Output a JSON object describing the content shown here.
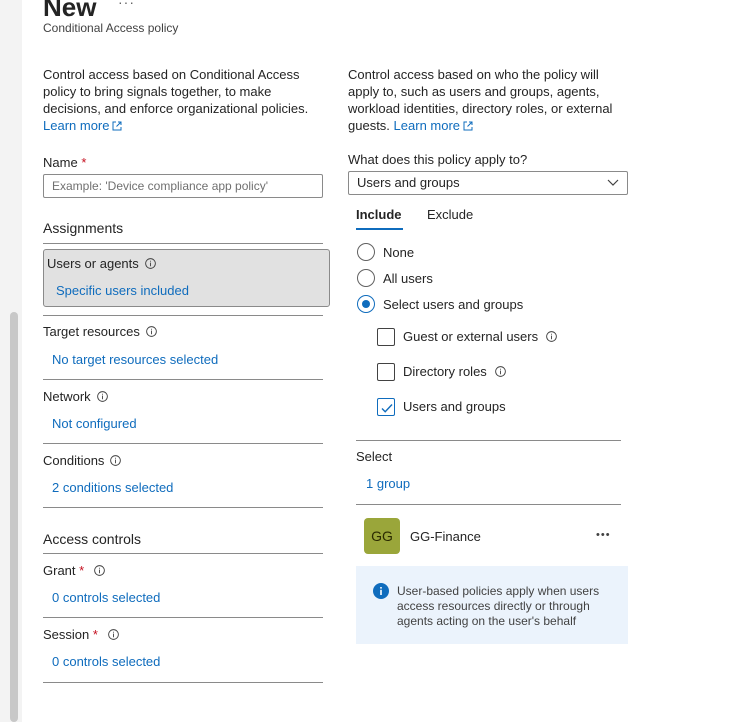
{
  "header": {
    "title": "New",
    "more": "···",
    "subtitle": "Conditional Access policy"
  },
  "left": {
    "description": "Control access based on Conditional Access policy to bring signals together, to make decisions, and enforce organizational policies.",
    "learn_more": "Learn more",
    "name_label": "Name",
    "required_mark": "*",
    "name_placeholder": "Example: 'Device compliance app policy'",
    "assignments_heading": "Assignments",
    "assignments": [
      {
        "label": "Users or agents",
        "value": "Specific users included"
      },
      {
        "label": "Target resources",
        "value": "No target resources selected"
      },
      {
        "label": "Network",
        "value": "Not configured"
      },
      {
        "label": "Conditions",
        "value": "2 conditions selected"
      }
    ],
    "access_heading": "Access controls",
    "access": [
      {
        "label": "Grant",
        "value": "0 controls selected"
      },
      {
        "label": "Session",
        "value": "0 controls selected"
      }
    ]
  },
  "right": {
    "description": "Control access based on who the policy will apply to, such as users and groups, agents, workload identities, directory roles, or external guests.",
    "learn_more": "Learn more",
    "apply_label": "What does this policy apply to?",
    "apply_value": "Users and groups",
    "tabs": [
      "Include",
      "Exclude"
    ],
    "radios": [
      {
        "label": "None",
        "checked": false
      },
      {
        "label": "All users",
        "checked": false
      },
      {
        "label": "Select users and groups",
        "checked": true
      }
    ],
    "checkboxes": [
      {
        "label": "Guest or external users",
        "checked": false
      },
      {
        "label": "Directory roles",
        "checked": false
      },
      {
        "label": "Users and groups",
        "checked": true
      }
    ],
    "select_label": "Select",
    "select_value": "1 group",
    "member": {
      "initials": "GG",
      "name": "GG-Finance",
      "more": "•••"
    },
    "info_text": "User-based policies apply when users access resources directly or through agents acting on the user's behalf"
  },
  "colors": {
    "accent": "#0f6cbd",
    "avatar_bg": "#9aa63a",
    "info_bg": "#ebf3fc",
    "required": "#c50f1f"
  }
}
